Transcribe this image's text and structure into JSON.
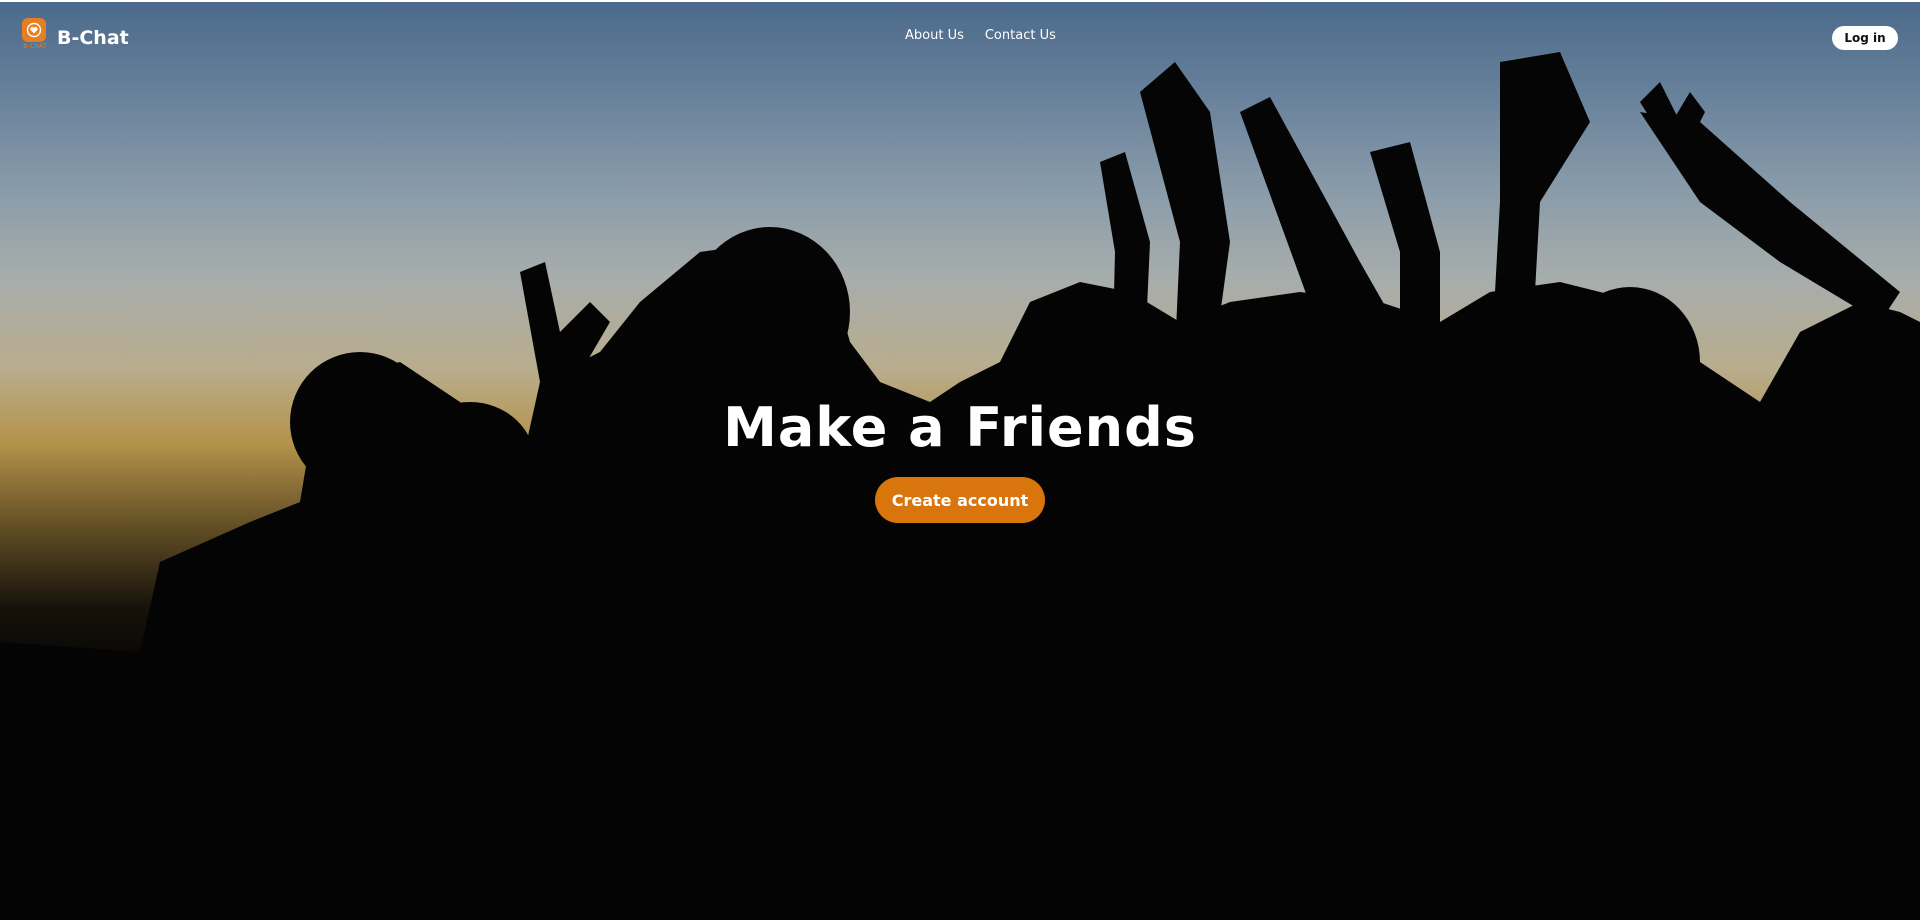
{
  "app": {
    "brand_name": "B-Chat",
    "logo_caption": "B-CHAT",
    "logo_icon": "heart-chat-icon"
  },
  "nav": {
    "links": [
      {
        "label": "About Us"
      },
      {
        "label": "Contact Us"
      }
    ],
    "login_label": "Log in"
  },
  "hero": {
    "headline": "Make a Friends",
    "cta_label": "Create account",
    "background": "silhouettes-at-sunset-photo"
  },
  "colors": {
    "accent": "#d8750d",
    "logo": "#e67e22",
    "text": "#ffffff"
  }
}
